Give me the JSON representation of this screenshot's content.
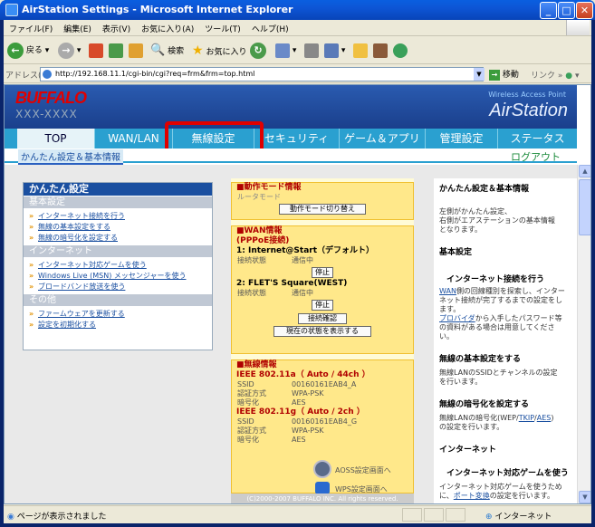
{
  "window": {
    "title": "AirStation Settings - Microsoft Internet Explorer"
  },
  "menu": [
    "ファイル(F)",
    "編集(E)",
    "表示(V)",
    "お気に入り(A)",
    "ツール(T)",
    "ヘルプ(H)"
  ],
  "toolbar": {
    "back": "戻る",
    "search": "検索",
    "favorites": "お気に入り"
  },
  "address": {
    "label": "アドレス(D)",
    "url": "http://192.168.11.1/cgi-bin/cgi?req=frm&frm=top.html",
    "go": "移動",
    "links": "リンク"
  },
  "banner": {
    "logo": "BUFFALO",
    "model": "XXX-XXXX",
    "wap": "Wireless Access Point",
    "product": "AirStation"
  },
  "nav": {
    "tabs": [
      "TOP",
      "WAN/LAN",
      "無線設定",
      "セキュリティ",
      "ゲーム＆アプリ",
      "管理設定",
      "ステータス"
    ],
    "breadcrumb": "かんたん設定＆基本情報",
    "logout": "ログアウト"
  },
  "easy": {
    "title": "かんたん設定",
    "sections": [
      {
        "name": "基本設定",
        "items": [
          "インターネット接続を行う",
          "無線の基本設定をする",
          "無線の暗号化を設定する"
        ]
      },
      {
        "name": "インターネット",
        "items": [
          "インターネット対応ゲームを使う",
          "Windows Live (MSN) メッセンジャーを使う",
          "ブロードバンド放送を使う"
        ]
      },
      {
        "name": "その他",
        "items": [
          "ファームウェアを更新する",
          "設定を初期化する"
        ]
      }
    ]
  },
  "mode": {
    "title": "■動作モード情報",
    "sub": "ルータモード",
    "button": "動作モード切り替え"
  },
  "wan": {
    "title": "■WAN情報",
    "subtitle": "(PPPoE接続)",
    "conn1": {
      "name": "1: Internet@Start（デフォルト）",
      "label": "接続状態",
      "status": "通信中",
      "button": "停止"
    },
    "conn2": {
      "name": "2: FLET'S Square(WEST)",
      "label": "接続状態",
      "status": "通信中",
      "button": "停止"
    },
    "check_button": "接続確認",
    "state_button": "現在の状態を表示する"
  },
  "wireless": {
    "title": "■無線情報",
    "a": {
      "header": "IEEE 802.11a（ Auto / 44ch ）",
      "ssid_label": "SSID",
      "ssid": "00160161EAB4_A",
      "auth_label": "認証方式",
      "auth": "WPA-PSK",
      "enc_label": "暗号化",
      "enc": "AES"
    },
    "g": {
      "header": "IEEE 802.11g（ Auto / 2ch ）",
      "ssid_label": "SSID",
      "ssid": "00160161EAB4_G",
      "auth_label": "認証方式",
      "auth": "WPA-PSK",
      "enc_label": "暗号化",
      "enc": "AES"
    },
    "aoss": "AOSS設定画面へ",
    "wps": "WPS設定画面へ"
  },
  "footer": "(C)2000-2007 BUFFALO INC. All rights reserved.",
  "help": {
    "title": "かんたん設定＆基本情報",
    "intro": [
      "左側がかんたん設定、",
      "右側がエアステーションの基本情報",
      "となります。"
    ],
    "basic": "基本設定",
    "h1": "インターネット接続を行う",
    "p1a": [
      "WAN",
      "側の回線種別を探索し、インター"
    ],
    "p1b": "ネット接続が完了するまでの設定をし",
    "p1c": "ます。",
    "p1d": [
      "プロバイダ",
      "から入手したパスワード等"
    ],
    "p1e": "の資料がある場合は用意してくださ",
    "p1f": "い。",
    "h2": "無線の基本設定をする",
    "p2": [
      "無線LANのSSIDとチャンネルの設定",
      "を行います。"
    ],
    "h3": "無線の暗号化を設定する",
    "p3a": [
      "無線LANの暗号化(WEP/",
      "TKIP",
      "/",
      "AES",
      ")"
    ],
    "p3b": "の設定を行います。",
    "internet": "インターネット",
    "h4": "インターネット対応ゲームを使う",
    "p4a": "インターネット対応ゲームを使うため",
    "p4b": [
      "に、",
      "ポート変換",
      "の設定を行います。"
    ]
  },
  "status": {
    "message": "ページが表示されました",
    "zone": "インターネット"
  }
}
